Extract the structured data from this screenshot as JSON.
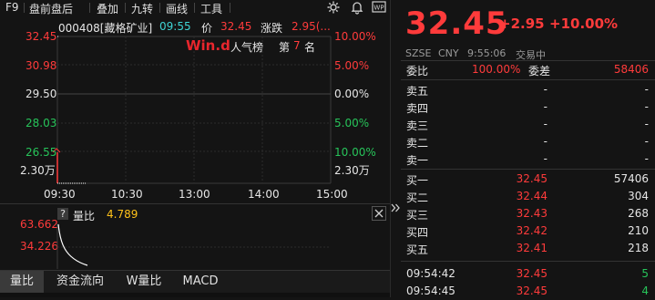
{
  "toolbar": {
    "items": [
      "F9",
      "盘前盘后",
      "叠加",
      "九转",
      "画线",
      "工具"
    ]
  },
  "chart": {
    "code_name": "000408[藏格矿业]",
    "time": "09:55",
    "price_label": "价",
    "price": "32.45",
    "change_label": "涨跌",
    "change": "2.95(...",
    "left_axis": [
      "32.45",
      "30.98",
      "29.50",
      "28.03",
      "26.55",
      "2.30万"
    ],
    "right_axis": [
      "10.00%",
      "5.00%",
      "0.00%",
      "5.00%",
      "10.00%",
      "2.30万"
    ],
    "time_axis": [
      "09:30",
      "10:30",
      "13:00",
      "14:00",
      "15:00"
    ],
    "popularity_label": "人气榜",
    "popularity_prefix": "第",
    "popularity_rank": "7",
    "popularity_suffix": "名",
    "colors": {
      "up": "#ff3b3b",
      "down": "#27c45a",
      "neutral": "#e6e6e6",
      "accent": "#ffc21a"
    }
  },
  "subchart": {
    "question": "?",
    "title": "量比",
    "value": "4.789",
    "axis": [
      "63.662",
      "34.226"
    ]
  },
  "tabs": [
    "量比",
    "资金流向",
    "W量比",
    "MACD"
  ],
  "quote": {
    "price": "32.45",
    "change": "+2.95",
    "change_pct": "+10.00%",
    "exchange": "SZSE",
    "currency": "CNY",
    "time": "9:55:06",
    "status": "交易中",
    "weibi_label": "委比",
    "weibi_value": "100.00%",
    "weicha_label": "委差",
    "weicha_value": "58406",
    "asks": [
      {
        "label": "卖五",
        "price": "-",
        "vol": "-"
      },
      {
        "label": "卖四",
        "price": "-",
        "vol": "-"
      },
      {
        "label": "卖三",
        "price": "-",
        "vol": "-"
      },
      {
        "label": "卖二",
        "price": "-",
        "vol": "-"
      },
      {
        "label": "卖一",
        "price": "-",
        "vol": "-"
      }
    ],
    "bids": [
      {
        "label": "买一",
        "price": "32.45",
        "vol": "57406"
      },
      {
        "label": "买二",
        "price": "32.44",
        "vol": "304"
      },
      {
        "label": "买三",
        "price": "32.43",
        "vol": "268"
      },
      {
        "label": "买四",
        "price": "32.42",
        "vol": "210"
      },
      {
        "label": "买五",
        "price": "32.41",
        "vol": "218"
      }
    ],
    "ticks": [
      {
        "time": "09:54:42",
        "price": "32.45",
        "vol": "5"
      },
      {
        "time": "09:54:45",
        "price": "32.45",
        "vol": "4"
      }
    ]
  }
}
